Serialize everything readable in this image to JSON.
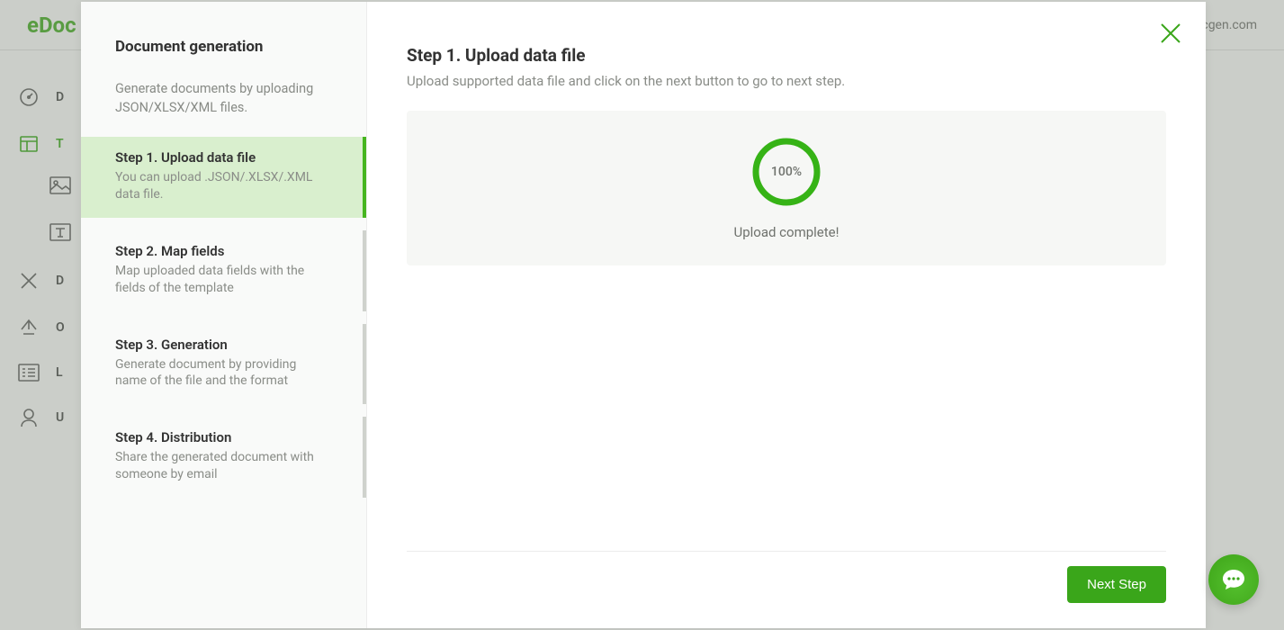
{
  "brand": {
    "logo": "eDoc",
    "domain_text": "cgen.com"
  },
  "sidebar": {
    "items": [
      {
        "code": "D"
      },
      {
        "code": "T"
      },
      {
        "code": "D"
      },
      {
        "code": "O"
      },
      {
        "code": "L"
      },
      {
        "code": "U"
      }
    ]
  },
  "modal": {
    "header_title": "Document generation",
    "header_desc": "Generate documents by uploading JSON/XLSX/XML files.",
    "steps": [
      {
        "title": "Step 1. Upload data file",
        "desc": "You can upload .JSON/.XLSX/.XML data file.",
        "active": true
      },
      {
        "title": "Step 2. Map fields",
        "desc": "Map uploaded data fields with the fields of the template",
        "active": false
      },
      {
        "title": "Step 3. Generation",
        "desc": "Generate document by providing name of the file and the format",
        "active": false
      },
      {
        "title": "Step 4. Distribution",
        "desc": "Share the generated document with someone by email",
        "active": false
      }
    ],
    "main": {
      "title": "Step 1. Upload data file",
      "desc": "Upload supported data file and click on the next button to go to next step.",
      "progress_percent": "100%",
      "upload_message": "Upload complete!"
    },
    "footer": {
      "next_label": "Next Step"
    }
  }
}
